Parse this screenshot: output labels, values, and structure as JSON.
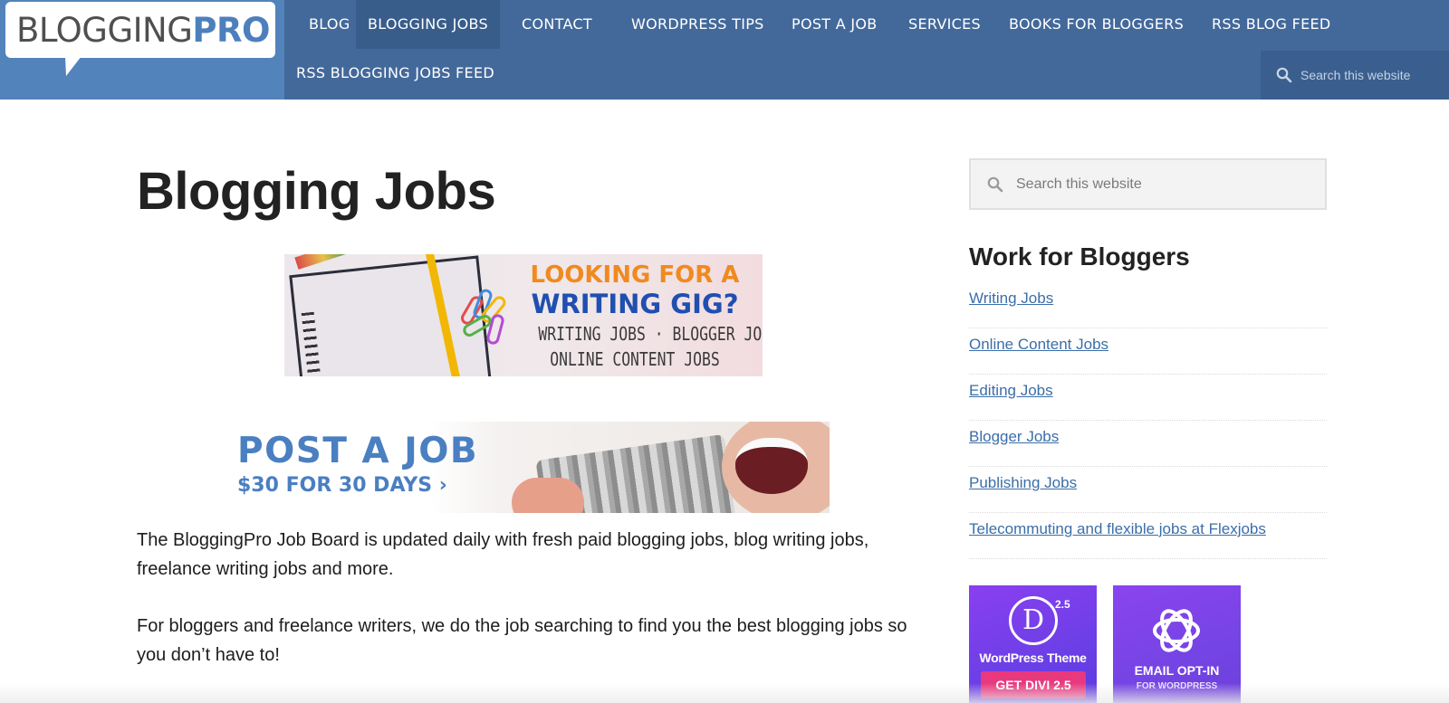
{
  "header": {
    "logo": {
      "part1": "BLOGGING",
      "part2": "PRO"
    },
    "nav": [
      {
        "label": "BLOG",
        "active": false
      },
      {
        "label": "BLOGGING JOBS",
        "active": true
      },
      {
        "label": "CONTACT",
        "active": false
      },
      {
        "label": "WORDPRESS TIPS",
        "active": false
      },
      {
        "label": "POST A JOB",
        "active": false
      },
      {
        "label": "SERVICES",
        "active": false
      },
      {
        "label": "BOOKS FOR BLOGGERS",
        "active": false
      },
      {
        "label": "RSS BLOG FEED",
        "active": false
      },
      {
        "label": "RSS BLOGGING JOBS FEED",
        "active": false
      }
    ],
    "search": {
      "placeholder": "Search this website",
      "icon": "search-icon"
    }
  },
  "main": {
    "title": "Blogging Jobs",
    "banner_writing_gig": {
      "line1": "LOOKING FOR A",
      "line2": "WRITING GIG?",
      "line3": "WRITING JOBS · BLOGGER JOBS",
      "line4": "ONLINE CONTENT JOBS"
    },
    "banner_post_job": {
      "line1": "POST A JOB",
      "line2": "$30 FOR 30 DAYS ›"
    },
    "paragraphs": [
      "The BloggingPro Job Board is updated daily with fresh paid blogging jobs, blog writing jobs, freelance writing jobs and more.",
      "For bloggers and freelance writers, we do the job searching to find you the best blogging jobs so you don’t have to!"
    ]
  },
  "sidebar": {
    "search": {
      "placeholder": "Search this website",
      "icon": "search-icon"
    },
    "widget_title": "Work for Bloggers",
    "links": [
      "Writing Jobs",
      "Online Content Jobs",
      "Editing Jobs",
      "Blogger Jobs",
      "Publishing Jobs",
      "Telecommuting and flexible jobs at Flexjobs"
    ],
    "ads": {
      "divi": {
        "logo_letter": "D",
        "version": "2.5",
        "text": "WordPress Theme",
        "button": "GET DIVI 2.5"
      },
      "email": {
        "line1": "EMAIL OPT-IN",
        "line2": "FOR WORDPRESS"
      }
    }
  },
  "colors": {
    "header_bg": "#5383bb",
    "nav_bg": "#43699a",
    "nav_active": "#395d8b",
    "link": "#3b6ea8",
    "logo_pro": "#4d7fbd"
  }
}
